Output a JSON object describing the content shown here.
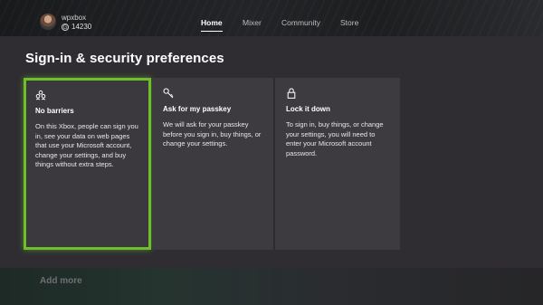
{
  "header": {
    "gamertag": "wpxbox",
    "gamerscore": "14230",
    "gamerscore_icon": "G",
    "nav": [
      {
        "label": "Home",
        "active": true
      },
      {
        "label": "Mixer",
        "active": false
      },
      {
        "label": "Community",
        "active": false
      },
      {
        "label": "Store",
        "active": false
      }
    ]
  },
  "page": {
    "title": "Sign-in & security preferences"
  },
  "options": [
    {
      "icon": "people-icon",
      "title": "No barriers",
      "description": "On this Xbox, people can sign you in, see your data on web pages that use your Microsoft account, change your settings, and buy things without extra steps.",
      "selected": true
    },
    {
      "icon": "key-icon",
      "title": "Ask for my passkey",
      "description": "We will ask for your passkey before you sign in, buy things, or change your settings.",
      "selected": false
    },
    {
      "icon": "lock-icon",
      "title": "Lock it down",
      "description": "To sign in, buy things, or change your settings, you will need to enter your Microsoft account password.",
      "selected": false
    }
  ],
  "footer": {
    "add_more": "Add more"
  },
  "colors": {
    "focus_green": "#6fbe2b",
    "background": "#2f2d31",
    "card": "#3d3a40"
  }
}
